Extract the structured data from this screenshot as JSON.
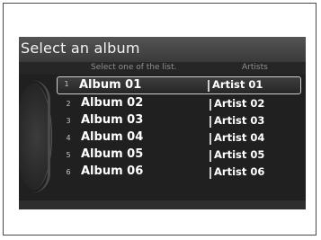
{
  "header": {
    "title": "Select an album"
  },
  "subheader": {
    "instruction": "Select one of the list.",
    "sort_label": "Artists"
  },
  "rows": [
    {
      "index": "1",
      "album": "Album 01",
      "artist": "Artist 01",
      "selected": true
    },
    {
      "index": "2",
      "album": "Album 02",
      "artist": "Artist 02",
      "selected": false
    },
    {
      "index": "3",
      "album": "Album 03",
      "artist": "Artist 03",
      "selected": false
    },
    {
      "index": "4",
      "album": "Album 04",
      "artist": "Artist 04",
      "selected": false
    },
    {
      "index": "5",
      "album": "Album 05",
      "artist": "Artist 05",
      "selected": false
    },
    {
      "index": "6",
      "album": "Album 06",
      "artist": "Artist 06",
      "selected": false
    }
  ],
  "colors": {
    "screen_bg": "#1a1a1a",
    "title_bar": "#484848",
    "text": "#ffffff",
    "highlight_border": "#cfcfcf"
  }
}
